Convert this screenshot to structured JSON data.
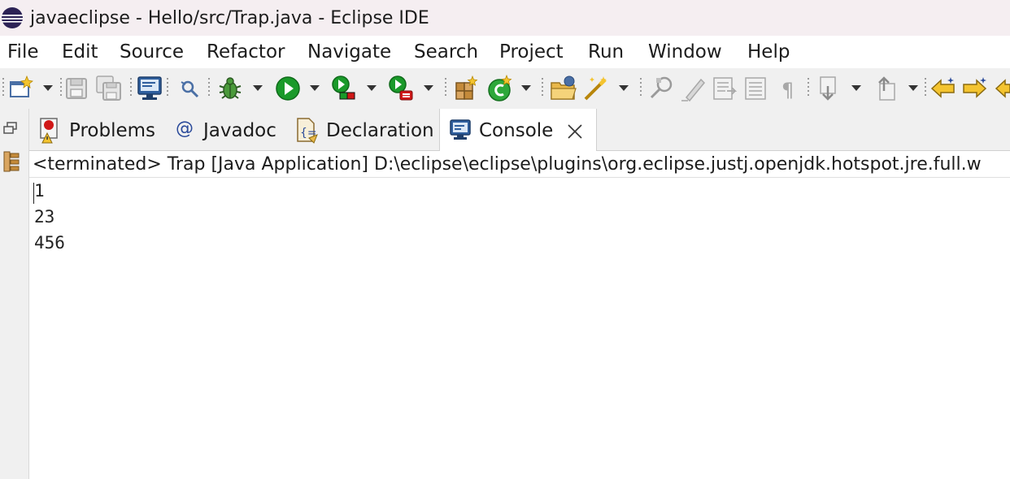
{
  "window": {
    "title": "javaeclipse - Hello/src/Trap.java - Eclipse IDE",
    "logo_icon": "eclipse-logo-icon"
  },
  "menu": {
    "items": [
      "File",
      "Edit",
      "Source",
      "Refactor",
      "Navigate",
      "Search",
      "Project",
      "Run",
      "Window",
      "Help"
    ]
  },
  "toolbar": {
    "icons": [
      "new-icon",
      "save-icon",
      "save-all-icon",
      "open-perspective-icon",
      "search-toggle-icon",
      "debug-icon",
      "run-icon",
      "coverage-icon",
      "run-external-tool-icon",
      "new-java-package-icon",
      "new-java-class-icon",
      "open-type-icon",
      "open-task-icon",
      "toggle-breadcrumb-icon",
      "mark-occurrences-icon",
      "toggle-block-selection-icon",
      "show-whitespace-icon",
      "next-annotation-icon",
      "previous-annotation-icon",
      "back-icon",
      "forward-icon"
    ]
  },
  "tabs": [
    {
      "label": "Problems",
      "icon": "problems-icon"
    },
    {
      "label": "Javadoc",
      "icon": "javadoc-icon"
    },
    {
      "label": "Declaration",
      "icon": "declaration-icon"
    },
    {
      "label": "Console",
      "icon": "console-icon",
      "active": true
    }
  ],
  "console": {
    "status": "<terminated> Trap [Java Application] D:\\eclipse\\eclipse\\plugins\\org.eclipse.justj.openjdk.hotspot.jre.full.w",
    "output": [
      "1",
      "23",
      "456"
    ]
  },
  "colors": {
    "title_bg": "#f5eef1",
    "toolbar_bg": "#f0f0f0",
    "run_green": "#1a9a2a",
    "eclipse_blue": "#2c2255"
  }
}
